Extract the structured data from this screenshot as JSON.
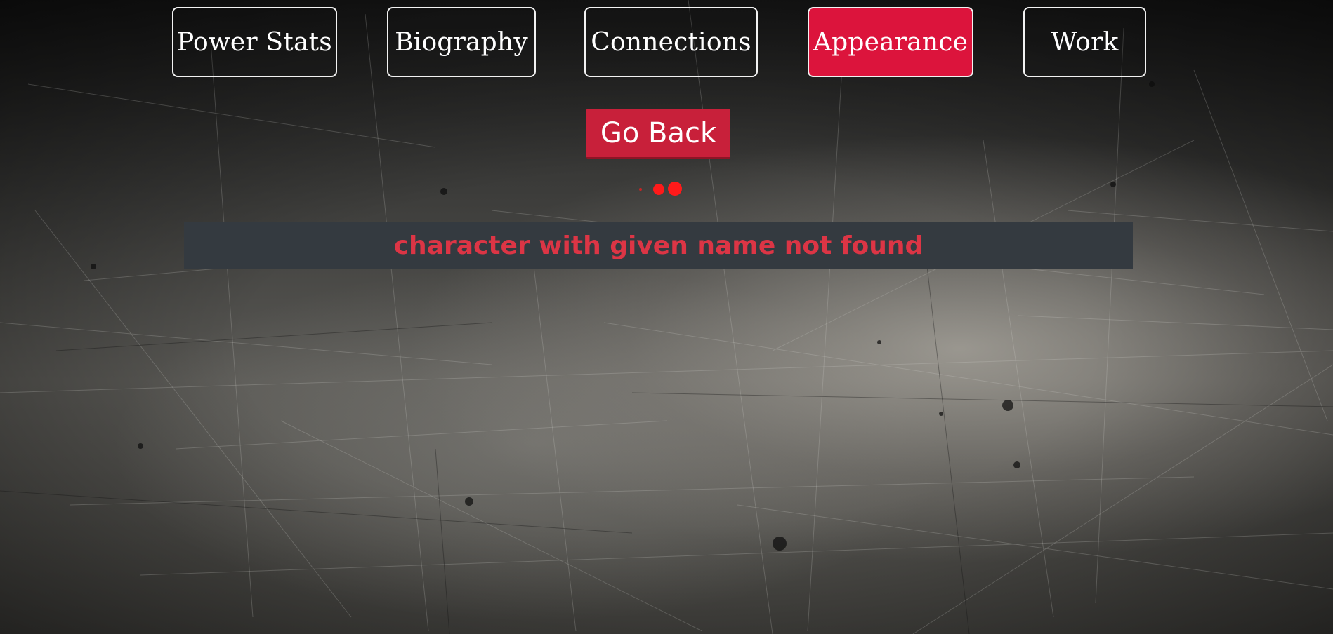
{
  "nav": {
    "tabs": [
      {
        "label": "Power Stats",
        "active": false
      },
      {
        "label": "Biography",
        "active": false
      },
      {
        "label": "Connections",
        "active": false
      },
      {
        "label": "Appearance",
        "active": true
      },
      {
        "label": "Work",
        "active": false
      }
    ]
  },
  "actions": {
    "go_back_label": "Go Back"
  },
  "loader": {
    "icon": "loading-dots-icon",
    "color": "#ff1a1a"
  },
  "error": {
    "message": "character with given name not found",
    "color": "#dc3545",
    "panel_color": "#343a40"
  },
  "colors": {
    "accent": "#dc143c",
    "button": "#c8203a"
  }
}
